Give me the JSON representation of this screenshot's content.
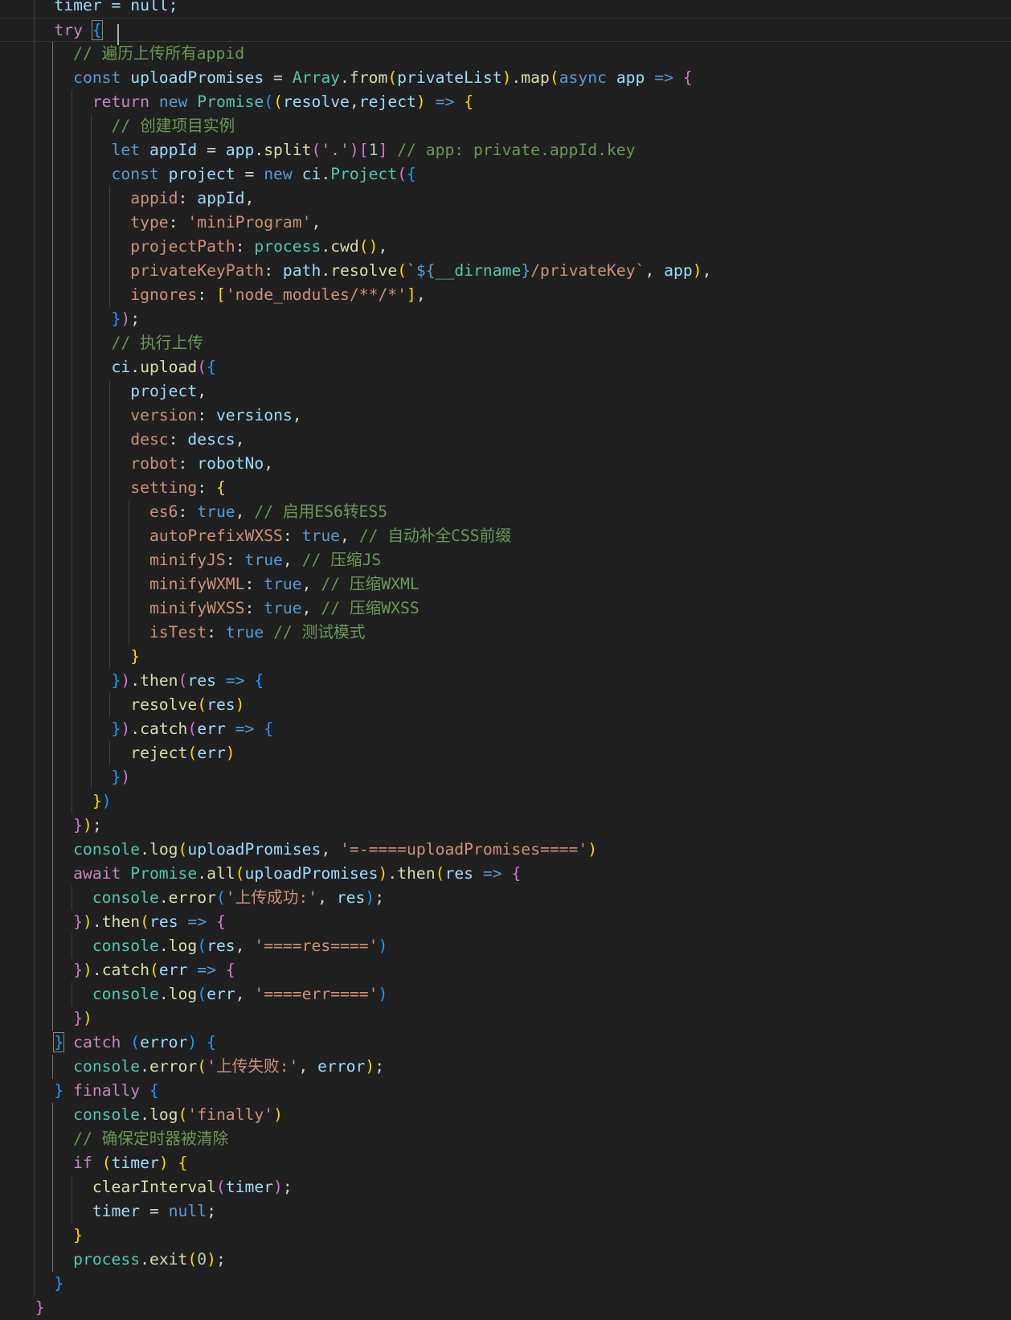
{
  "lines": [
    [
      [
        "    timer = null;",
        "var"
      ]
    ],
    [
      [
        "    ",
        "pun"
      ],
      [
        "try",
        "ctrl"
      ],
      [
        " ",
        "pun"
      ],
      [
        "{",
        "b3",
        "box"
      ]
    ],
    [
      [
        "      ",
        "pun"
      ],
      [
        "// 遍历上传所有appid",
        "com"
      ]
    ],
    [
      [
        "      ",
        "pun"
      ],
      [
        "const",
        "kw"
      ],
      [
        " ",
        "pun"
      ],
      [
        "uploadPromises",
        "var"
      ],
      [
        " = ",
        "pun"
      ],
      [
        "Array",
        "cls"
      ],
      [
        ".",
        "pun"
      ],
      [
        "from",
        "fn"
      ],
      [
        "(",
        "b1"
      ],
      [
        "privateList",
        "var"
      ],
      [
        ")",
        "b1"
      ],
      [
        ".",
        "pun"
      ],
      [
        "map",
        "fn"
      ],
      [
        "(",
        "b1"
      ],
      [
        "async",
        "kw"
      ],
      [
        " ",
        "pun"
      ],
      [
        "app",
        "var"
      ],
      [
        " ",
        "pun"
      ],
      [
        "=>",
        "kw"
      ],
      [
        " ",
        "pun"
      ],
      [
        "{",
        "b2"
      ]
    ],
    [
      [
        "        ",
        "pun"
      ],
      [
        "return",
        "ctrl"
      ],
      [
        " ",
        "pun"
      ],
      [
        "new",
        "kw"
      ],
      [
        " ",
        "pun"
      ],
      [
        "Promise",
        "cls"
      ],
      [
        "(",
        "b3"
      ],
      [
        "(",
        "b1"
      ],
      [
        "resolve",
        "var"
      ],
      [
        ",",
        "pun"
      ],
      [
        "reject",
        "var"
      ],
      [
        ")",
        "b1"
      ],
      [
        " ",
        "pun"
      ],
      [
        "=>",
        "kw"
      ],
      [
        " ",
        "pun"
      ],
      [
        "{",
        "b1"
      ]
    ],
    [
      [
        "          ",
        "pun"
      ],
      [
        "// 创建项目实例",
        "com"
      ]
    ],
    [
      [
        "          ",
        "pun"
      ],
      [
        "let",
        "kw"
      ],
      [
        " ",
        "pun"
      ],
      [
        "appId",
        "var"
      ],
      [
        " = ",
        "pun"
      ],
      [
        "app",
        "var"
      ],
      [
        ".",
        "pun"
      ],
      [
        "split",
        "fn"
      ],
      [
        "(",
        "b2"
      ],
      [
        "'.'",
        "str"
      ],
      [
        ")",
        "b2"
      ],
      [
        "[",
        "b2"
      ],
      [
        "1",
        "num"
      ],
      [
        "]",
        "b2"
      ],
      [
        " ",
        "pun"
      ],
      [
        "// app: private.appId.key",
        "com"
      ]
    ],
    [
      [
        "          ",
        "pun"
      ],
      [
        "const",
        "kw"
      ],
      [
        " ",
        "pun"
      ],
      [
        "project",
        "var"
      ],
      [
        " = ",
        "pun"
      ],
      [
        "new",
        "kw"
      ],
      [
        " ",
        "pun"
      ],
      [
        "ci",
        "var"
      ],
      [
        ".",
        "pun"
      ],
      [
        "Project",
        "cls"
      ],
      [
        "(",
        "b2"
      ],
      [
        "{",
        "b3"
      ]
    ],
    [
      [
        "            ",
        "pun"
      ],
      [
        "appid",
        "str"
      ],
      [
        ": ",
        "pun"
      ],
      [
        "appId",
        "var"
      ],
      [
        ",",
        "pun"
      ]
    ],
    [
      [
        "            ",
        "pun"
      ],
      [
        "type",
        "str"
      ],
      [
        ": ",
        "pun"
      ],
      [
        "'miniProgram'",
        "str"
      ],
      [
        ",",
        "pun"
      ]
    ],
    [
      [
        "            ",
        "pun"
      ],
      [
        "projectPath",
        "str"
      ],
      [
        ": ",
        "pun"
      ],
      [
        "process",
        "cls"
      ],
      [
        ".",
        "pun"
      ],
      [
        "cwd",
        "fn"
      ],
      [
        "(",
        "b1"
      ],
      [
        ")",
        "b1"
      ],
      [
        ",",
        "pun"
      ]
    ],
    [
      [
        "            ",
        "pun"
      ],
      [
        "privateKeyPath",
        "str"
      ],
      [
        ": ",
        "pun"
      ],
      [
        "path",
        "var"
      ],
      [
        ".",
        "pun"
      ],
      [
        "resolve",
        "fn"
      ],
      [
        "(",
        "b1"
      ],
      [
        "`",
        "str"
      ],
      [
        "${",
        "kw"
      ],
      [
        "__dirname",
        "cls"
      ],
      [
        "}",
        "kw"
      ],
      [
        "/privateKey`",
        "str"
      ],
      [
        ", ",
        "pun"
      ],
      [
        "app",
        "var"
      ],
      [
        ")",
        "b1"
      ],
      [
        ",",
        "pun"
      ]
    ],
    [
      [
        "            ",
        "pun"
      ],
      [
        "ignores",
        "str"
      ],
      [
        ": ",
        "pun"
      ],
      [
        "[",
        "b1"
      ],
      [
        "'node_modules/**/*'",
        "str"
      ],
      [
        "]",
        "b1"
      ],
      [
        ",",
        "pun"
      ]
    ],
    [
      [
        "          ",
        "pun"
      ],
      [
        "}",
        "b3"
      ],
      [
        ")",
        "b2"
      ],
      [
        ";",
        "pun"
      ]
    ],
    [
      [
        "          ",
        "pun"
      ],
      [
        "// 执行上传",
        "com"
      ]
    ],
    [
      [
        "          ",
        "pun"
      ],
      [
        "ci",
        "var"
      ],
      [
        ".",
        "pun"
      ],
      [
        "upload",
        "fn"
      ],
      [
        "(",
        "b2"
      ],
      [
        "{",
        "b3"
      ]
    ],
    [
      [
        "            ",
        "pun"
      ],
      [
        "project",
        "var"
      ],
      [
        ",",
        "pun"
      ]
    ],
    [
      [
        "            ",
        "pun"
      ],
      [
        "version",
        "str"
      ],
      [
        ": ",
        "pun"
      ],
      [
        "versions",
        "var"
      ],
      [
        ",",
        "pun"
      ]
    ],
    [
      [
        "            ",
        "pun"
      ],
      [
        "desc",
        "str"
      ],
      [
        ": ",
        "pun"
      ],
      [
        "descs",
        "var"
      ],
      [
        ",",
        "pun"
      ]
    ],
    [
      [
        "            ",
        "pun"
      ],
      [
        "robot",
        "str"
      ],
      [
        ": ",
        "pun"
      ],
      [
        "robotNo",
        "var"
      ],
      [
        ",",
        "pun"
      ]
    ],
    [
      [
        "            ",
        "pun"
      ],
      [
        "setting",
        "str"
      ],
      [
        ": ",
        "pun"
      ],
      [
        "{",
        "b1"
      ]
    ],
    [
      [
        "              ",
        "pun"
      ],
      [
        "es6",
        "str"
      ],
      [
        ": ",
        "pun"
      ],
      [
        "true",
        "kw"
      ],
      [
        ", ",
        "pun"
      ],
      [
        "// 启用ES6转ES5",
        "com"
      ]
    ],
    [
      [
        "              ",
        "pun"
      ],
      [
        "autoPrefixWXSS",
        "str"
      ],
      [
        ": ",
        "pun"
      ],
      [
        "true",
        "kw"
      ],
      [
        ", ",
        "pun"
      ],
      [
        "// 自动补全CSS前缀",
        "com"
      ]
    ],
    [
      [
        "              ",
        "pun"
      ],
      [
        "minifyJS",
        "str"
      ],
      [
        ": ",
        "pun"
      ],
      [
        "true",
        "kw"
      ],
      [
        ", ",
        "pun"
      ],
      [
        "// 压缩JS",
        "com"
      ]
    ],
    [
      [
        "              ",
        "pun"
      ],
      [
        "minifyWXML",
        "str"
      ],
      [
        ": ",
        "pun"
      ],
      [
        "true",
        "kw"
      ],
      [
        ", ",
        "pun"
      ],
      [
        "// 压缩WXML",
        "com"
      ]
    ],
    [
      [
        "              ",
        "pun"
      ],
      [
        "minifyWXSS",
        "str"
      ],
      [
        ": ",
        "pun"
      ],
      [
        "true",
        "kw"
      ],
      [
        ", ",
        "pun"
      ],
      [
        "// 压缩WXSS",
        "com"
      ]
    ],
    [
      [
        "              ",
        "pun"
      ],
      [
        "isTest",
        "str"
      ],
      [
        ": ",
        "pun"
      ],
      [
        "true",
        "kw"
      ],
      [
        " ",
        "pun"
      ],
      [
        "// 测试模式",
        "com"
      ]
    ],
    [
      [
        "            ",
        "pun"
      ],
      [
        "}",
        "b1"
      ]
    ],
    [
      [
        "          ",
        "pun"
      ],
      [
        "}",
        "b3"
      ],
      [
        ")",
        "b2"
      ],
      [
        ".",
        "pun"
      ],
      [
        "then",
        "fn"
      ],
      [
        "(",
        "b2"
      ],
      [
        "res",
        "var"
      ],
      [
        " ",
        "pun"
      ],
      [
        "=>",
        "kw"
      ],
      [
        " ",
        "pun"
      ],
      [
        "{",
        "b3"
      ]
    ],
    [
      [
        "            ",
        "pun"
      ],
      [
        "resolve",
        "fn"
      ],
      [
        "(",
        "b1"
      ],
      [
        "res",
        "var"
      ],
      [
        ")",
        "b1"
      ]
    ],
    [
      [
        "          ",
        "pun"
      ],
      [
        "}",
        "b3"
      ],
      [
        ")",
        "b2"
      ],
      [
        ".",
        "pun"
      ],
      [
        "catch",
        "fn"
      ],
      [
        "(",
        "b2"
      ],
      [
        "err",
        "var"
      ],
      [
        " ",
        "pun"
      ],
      [
        "=>",
        "kw"
      ],
      [
        " ",
        "pun"
      ],
      [
        "{",
        "b3"
      ]
    ],
    [
      [
        "            ",
        "pun"
      ],
      [
        "reject",
        "fn"
      ],
      [
        "(",
        "b1"
      ],
      [
        "err",
        "var"
      ],
      [
        ")",
        "b1"
      ]
    ],
    [
      [
        "          ",
        "pun"
      ],
      [
        "}",
        "b3"
      ],
      [
        ")",
        "b2"
      ]
    ],
    [
      [
        "        ",
        "pun"
      ],
      [
        "}",
        "b1"
      ],
      [
        ")",
        "b3"
      ]
    ],
    [
      [
        "      ",
        "pun"
      ],
      [
        "}",
        "b2"
      ],
      [
        ")",
        "b1"
      ],
      [
        ";",
        "pun"
      ]
    ],
    [
      [
        "      ",
        "pun"
      ],
      [
        "console",
        "cls"
      ],
      [
        ".",
        "pun"
      ],
      [
        "log",
        "fn"
      ],
      [
        "(",
        "b1"
      ],
      [
        "uploadPromises",
        "var"
      ],
      [
        ", ",
        "pun"
      ],
      [
        "'=-====uploadPromises===='",
        "str"
      ],
      [
        ")",
        "b1"
      ]
    ],
    [
      [
        "      ",
        "pun"
      ],
      [
        "await",
        "ctrl"
      ],
      [
        " ",
        "pun"
      ],
      [
        "Promise",
        "cls"
      ],
      [
        ".",
        "pun"
      ],
      [
        "all",
        "fn"
      ],
      [
        "(",
        "b1"
      ],
      [
        "uploadPromises",
        "var"
      ],
      [
        ")",
        "b1"
      ],
      [
        ".",
        "pun"
      ],
      [
        "then",
        "fn"
      ],
      [
        "(",
        "b1"
      ],
      [
        "res",
        "var"
      ],
      [
        " ",
        "pun"
      ],
      [
        "=>",
        "kw"
      ],
      [
        " ",
        "pun"
      ],
      [
        "{",
        "b2"
      ]
    ],
    [
      [
        "        ",
        "pun"
      ],
      [
        "console",
        "cls"
      ],
      [
        ".",
        "pun"
      ],
      [
        "error",
        "fn"
      ],
      [
        "(",
        "b3"
      ],
      [
        "'上传成功:'",
        "str"
      ],
      [
        ", ",
        "pun"
      ],
      [
        "res",
        "var"
      ],
      [
        ")",
        "b3"
      ],
      [
        ";",
        "pun"
      ]
    ],
    [
      [
        "      ",
        "pun"
      ],
      [
        "}",
        "b2"
      ],
      [
        ")",
        "b1"
      ],
      [
        ".",
        "pun"
      ],
      [
        "then",
        "fn"
      ],
      [
        "(",
        "b1"
      ],
      [
        "res",
        "var"
      ],
      [
        " ",
        "pun"
      ],
      [
        "=>",
        "kw"
      ],
      [
        " ",
        "pun"
      ],
      [
        "{",
        "b2"
      ]
    ],
    [
      [
        "        ",
        "pun"
      ],
      [
        "console",
        "cls"
      ],
      [
        ".",
        "pun"
      ],
      [
        "log",
        "fn"
      ],
      [
        "(",
        "b3"
      ],
      [
        "res",
        "var"
      ],
      [
        ", ",
        "pun"
      ],
      [
        "'====res===='",
        "str"
      ],
      [
        ")",
        "b3"
      ]
    ],
    [
      [
        "      ",
        "pun"
      ],
      [
        "}",
        "b2"
      ],
      [
        ")",
        "b1"
      ],
      [
        ".",
        "pun"
      ],
      [
        "catch",
        "fn"
      ],
      [
        "(",
        "b1"
      ],
      [
        "err",
        "var"
      ],
      [
        " ",
        "pun"
      ],
      [
        "=>",
        "kw"
      ],
      [
        " ",
        "pun"
      ],
      [
        "{",
        "b2"
      ]
    ],
    [
      [
        "        ",
        "pun"
      ],
      [
        "console",
        "cls"
      ],
      [
        ".",
        "pun"
      ],
      [
        "log",
        "fn"
      ],
      [
        "(",
        "b3"
      ],
      [
        "err",
        "var"
      ],
      [
        ", ",
        "pun"
      ],
      [
        "'====err===='",
        "str"
      ],
      [
        ")",
        "b3"
      ]
    ],
    [
      [
        "      ",
        "pun"
      ],
      [
        "}",
        "b2"
      ],
      [
        ")",
        "b1"
      ]
    ],
    [
      [
        "    ",
        "pun"
      ],
      [
        "}",
        "b3",
        "box"
      ],
      [
        " ",
        "pun"
      ],
      [
        "catch",
        "ctrl"
      ],
      [
        " ",
        "pun"
      ],
      [
        "(",
        "b3"
      ],
      [
        "error",
        "var"
      ],
      [
        ")",
        "b3"
      ],
      [
        " ",
        "pun"
      ],
      [
        "{",
        "b3"
      ]
    ],
    [
      [
        "      ",
        "pun"
      ],
      [
        "console",
        "cls"
      ],
      [
        ".",
        "pun"
      ],
      [
        "error",
        "fn"
      ],
      [
        "(",
        "b1"
      ],
      [
        "'上传失败:'",
        "str"
      ],
      [
        ", ",
        "pun"
      ],
      [
        "error",
        "var"
      ],
      [
        ")",
        "b1"
      ],
      [
        ";",
        "pun"
      ]
    ],
    [
      [
        "    ",
        "pun"
      ],
      [
        "}",
        "b3"
      ],
      [
        " ",
        "pun"
      ],
      [
        "finally",
        "ctrl"
      ],
      [
        " ",
        "pun"
      ],
      [
        "{",
        "b3"
      ]
    ],
    [
      [
        "      ",
        "pun"
      ],
      [
        "console",
        "cls"
      ],
      [
        ".",
        "pun"
      ],
      [
        "log",
        "fn"
      ],
      [
        "(",
        "b1"
      ],
      [
        "'finally'",
        "str"
      ],
      [
        ")",
        "b1"
      ]
    ],
    [
      [
        "      ",
        "pun"
      ],
      [
        "// 确保定时器被清除",
        "com"
      ]
    ],
    [
      [
        "      ",
        "pun"
      ],
      [
        "if",
        "ctrl"
      ],
      [
        " ",
        "pun"
      ],
      [
        "(",
        "b1"
      ],
      [
        "timer",
        "var"
      ],
      [
        ")",
        "b1"
      ],
      [
        " ",
        "pun"
      ],
      [
        "{",
        "b1"
      ]
    ],
    [
      [
        "        ",
        "pun"
      ],
      [
        "clearInterval",
        "fn"
      ],
      [
        "(",
        "b2"
      ],
      [
        "timer",
        "var"
      ],
      [
        ")",
        "b2"
      ],
      [
        ";",
        "pun"
      ]
    ],
    [
      [
        "        ",
        "pun"
      ],
      [
        "timer",
        "var"
      ],
      [
        " = ",
        "pun"
      ],
      [
        "null",
        "kw"
      ],
      [
        ";",
        "pun"
      ]
    ],
    [
      [
        "      ",
        "pun"
      ],
      [
        "}",
        "b1"
      ]
    ],
    [
      [
        "      ",
        "pun"
      ],
      [
        "process",
        "cls"
      ],
      [
        ".",
        "pun"
      ],
      [
        "exit",
        "fn"
      ],
      [
        "(",
        "b1"
      ],
      [
        "0",
        "num"
      ],
      [
        ")",
        "b1"
      ],
      [
        ";",
        "pun"
      ]
    ],
    [
      [
        "    ",
        "pun"
      ],
      [
        "}",
        "b3"
      ]
    ],
    [
      [
        "  ",
        "pun"
      ],
      [
        "}",
        "b2"
      ]
    ]
  ]
}
